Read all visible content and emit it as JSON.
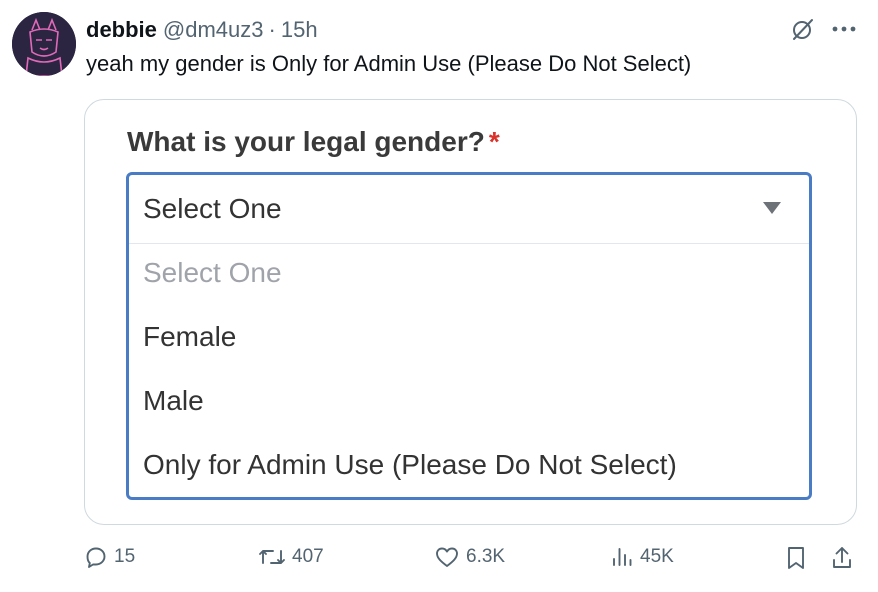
{
  "tweet": {
    "author_name": "debbie",
    "handle": "@dm4uz3",
    "separator": "·",
    "time": "15h",
    "text": "yeah my gender is Only for Admin Use (Please Do Not Select)"
  },
  "form": {
    "question": "What is your legal gender?",
    "required_mark": "*",
    "selected_value": "Select One",
    "options": [
      "Select One",
      "Female",
      "Male",
      "Only for Admin Use (Please Do Not Select)"
    ]
  },
  "actions": {
    "replies": "15",
    "reposts": "407",
    "likes": "6.3K",
    "views": "45K"
  },
  "icons": {
    "grok": "grok-icon",
    "more": "more-icon",
    "reply": "reply-icon",
    "repost": "repost-icon",
    "like": "heart-icon",
    "views": "views-icon",
    "bookmark": "bookmark-icon",
    "share": "share-icon"
  },
  "colors": {
    "focus_border": "#4a7cc5",
    "required": "#d9332b",
    "muted_text": "#536471",
    "placeholder_text": "#a0a4aa"
  }
}
